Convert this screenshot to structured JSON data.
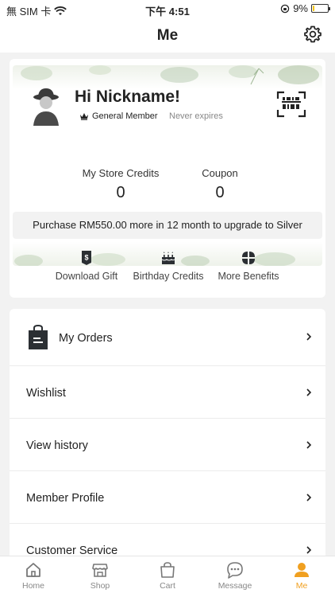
{
  "status_bar": {
    "carrier": "無 SIM 卡",
    "time": "下午 4:51",
    "battery_percent": "9%",
    "battery_level": 0.09,
    "charging_color": "#f5c400"
  },
  "header": {
    "title": "Me",
    "settings_icon": "gear-icon"
  },
  "member_card": {
    "greeting": "Hi Nickname!",
    "level": "General Member",
    "expiry": "Never expires",
    "store_credits_label": "My Store Credits",
    "store_credits_value": "0",
    "coupon_label": "Coupon",
    "coupon_value": "0",
    "upgrade_message": "Purchase RM550.00 more in 12 month to upgrade to Silver"
  },
  "benefits": [
    {
      "label": "Download Gift",
      "icon": "gift-tag-icon"
    },
    {
      "label": "Birthday Credits",
      "icon": "cake-icon"
    },
    {
      "label": "More Benefits",
      "icon": "grid-icon"
    }
  ],
  "menu": [
    {
      "label": "My Orders",
      "icon": "shopping-bag-icon"
    },
    {
      "label": "Wishlist"
    },
    {
      "label": "View history"
    },
    {
      "label": "Member Profile"
    },
    {
      "label": "Customer Service"
    }
  ],
  "tabs": [
    {
      "label": "Home",
      "icon": "home-icon"
    },
    {
      "label": "Shop",
      "icon": "shop-icon"
    },
    {
      "label": "Cart",
      "icon": "cart-icon"
    },
    {
      "label": "Message",
      "icon": "message-icon"
    },
    {
      "label": "Me",
      "icon": "person-icon"
    }
  ],
  "colors": {
    "accent": "#f0a020",
    "text": "#222222",
    "muted": "#888888",
    "page_bg": "#f2f2f2"
  }
}
